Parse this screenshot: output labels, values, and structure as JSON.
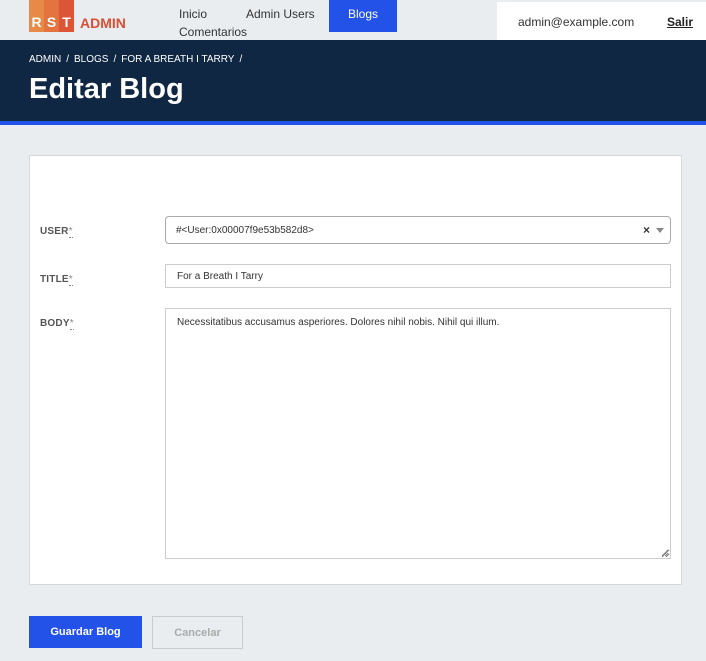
{
  "logo": {
    "letters": [
      "R",
      "S",
      "T"
    ],
    "admin": "ADMIN",
    "colors": [
      "#e88a47",
      "#e3743f",
      "#dd5537"
    ]
  },
  "nav": {
    "items": [
      {
        "label": "Inicio"
      },
      {
        "label": "Admin Users"
      },
      {
        "label": "Blogs",
        "active": true
      },
      {
        "label": "Comentarios"
      }
    ]
  },
  "user": {
    "email": "admin@example.com",
    "logout": "Salir"
  },
  "breadcrumb": [
    "Admin",
    "Blogs",
    "For a Breath I Tarry"
  ],
  "page": {
    "title": "Editar Blog"
  },
  "form": {
    "user": {
      "label": "User",
      "required_mark": "*",
      "value": "#<User:0x00007f9e53b582d8>"
    },
    "title": {
      "label": "Title",
      "required_mark": "*",
      "value": "For a Breath I Tarry"
    },
    "body": {
      "label": "Body",
      "required_mark": "*",
      "value": "Necessitatibus accusamus asperiores. Dolores nihil nobis. Nihil qui illum."
    }
  },
  "actions": {
    "save": "Guardar Blog",
    "cancel": "Cancelar"
  },
  "colors": {
    "accent": "#2352e8",
    "header_bg": "#0f2742",
    "page_bg": "#eaedf0",
    "brand": "#d84f33"
  }
}
